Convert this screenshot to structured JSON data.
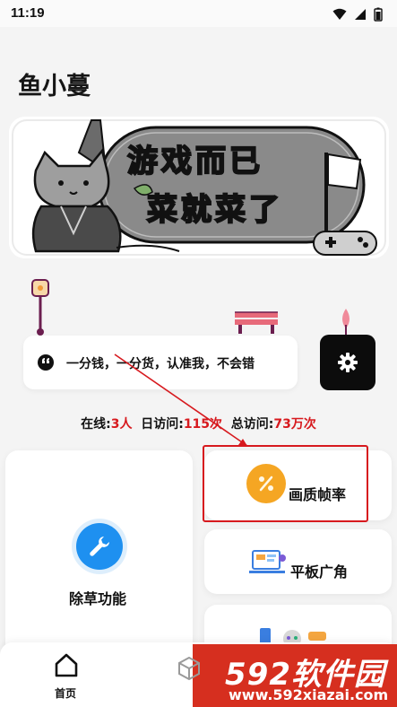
{
  "status_bar": {
    "time": "11:19"
  },
  "app": {
    "title": "鱼小蔓"
  },
  "banner": {
    "line1": "游戏而已",
    "line2": "菜就菜了"
  },
  "notice": {
    "text": "一分钱，一分货，认准我，不会错"
  },
  "stats": {
    "online_label": "在线:",
    "online_value": "3人",
    "daily_label": "日访问:",
    "daily_value": "115次",
    "total_label": "总访问:",
    "total_value": "73万次"
  },
  "features": {
    "weeding": "除草功能",
    "quality_fps": "画质帧率",
    "tablet_wide": "平板广角"
  },
  "bottom_nav": {
    "home": "首页"
  },
  "watermark": {
    "brand": "592软件园",
    "url": "www.592xiazai.com"
  },
  "colors": {
    "accent_red": "#d7191e",
    "settings_bg": "#0c0c0c",
    "wrench_blue": "#1e90f0",
    "percent_orange": "#f5a623"
  }
}
